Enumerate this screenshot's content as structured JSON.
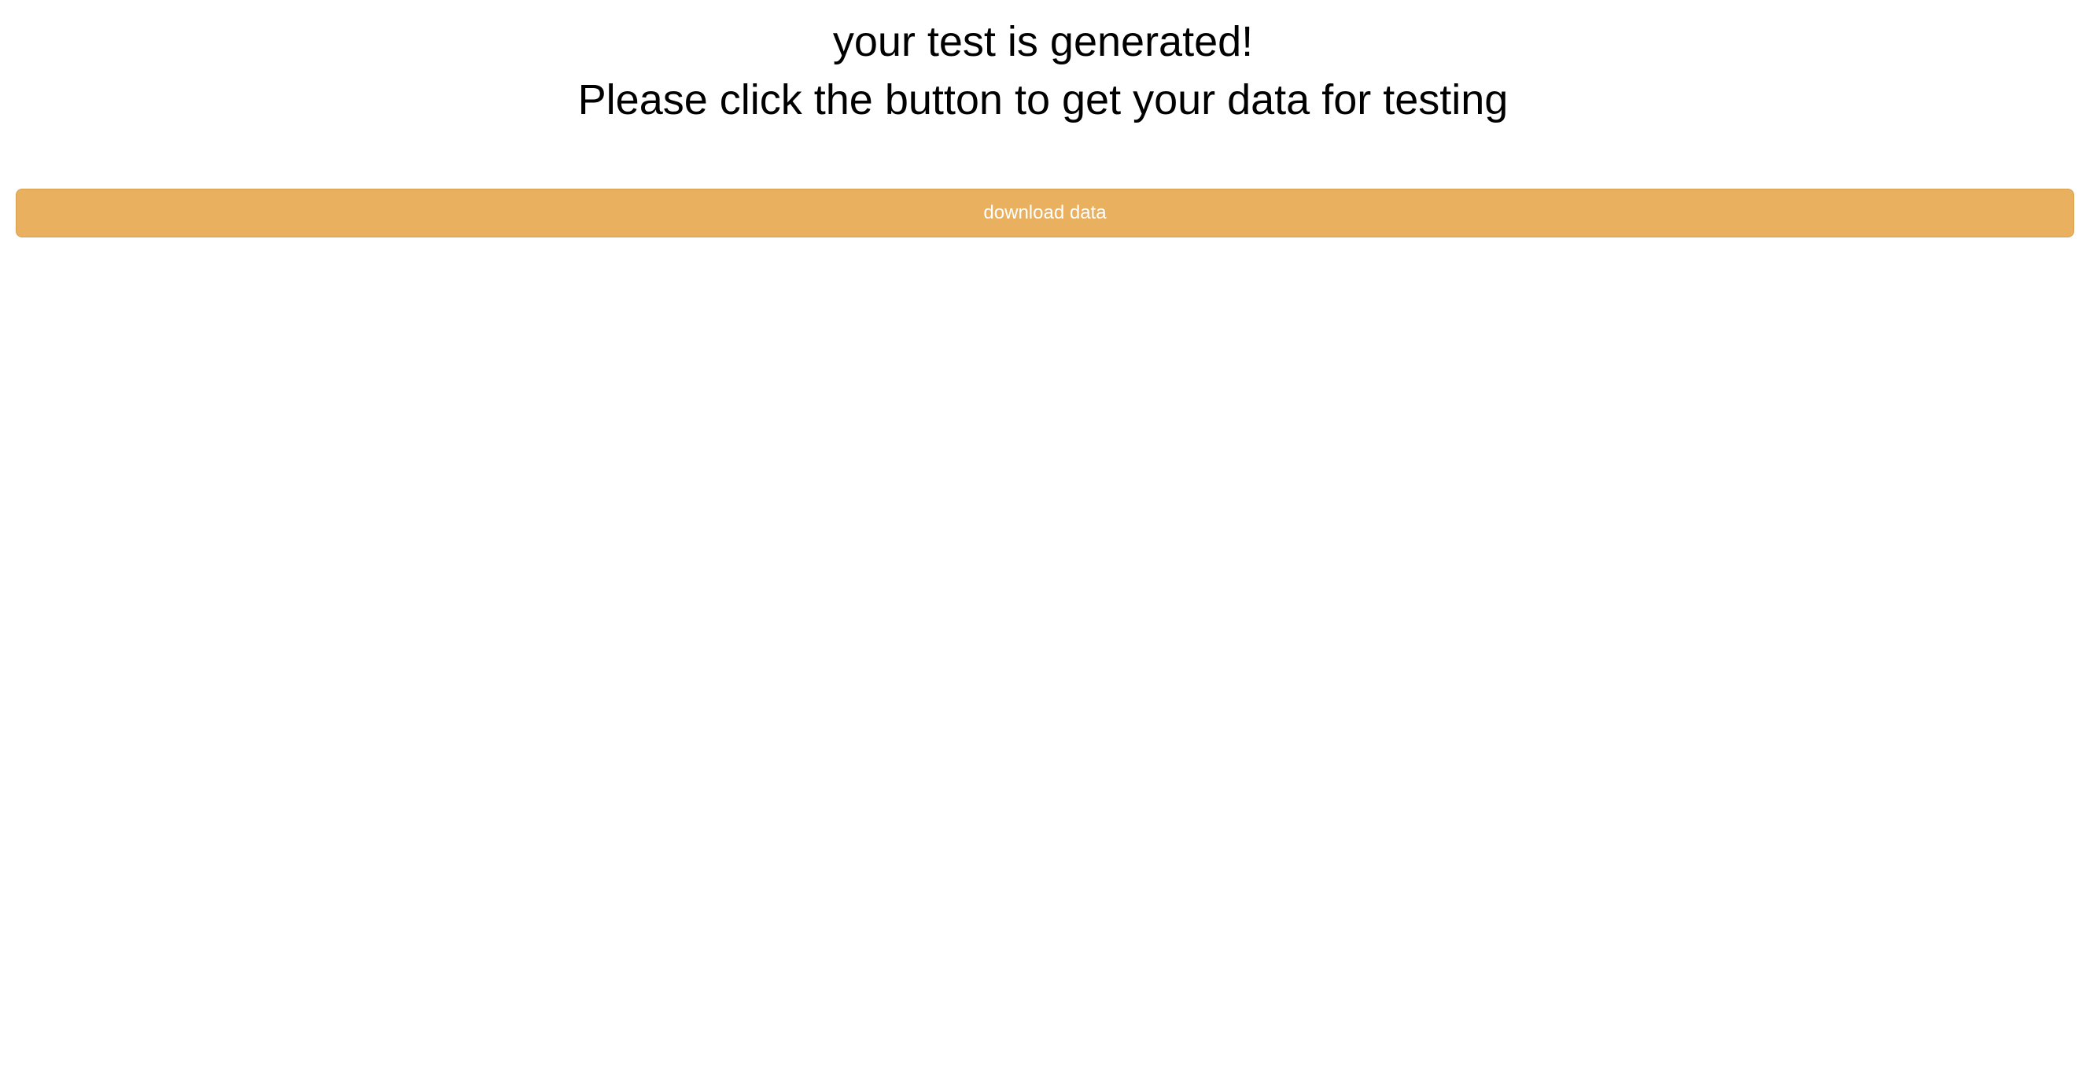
{
  "page": {
    "title_line1": "your test is generated!",
    "title_line2": "Please click the button to get your data for testing"
  },
  "download": {
    "label": "download data",
    "color": "#e8b05f"
  }
}
